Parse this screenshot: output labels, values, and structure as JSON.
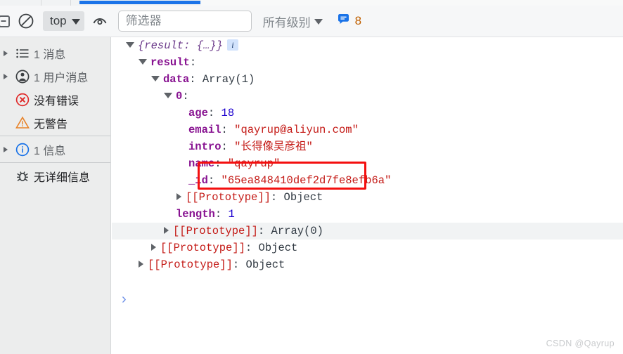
{
  "window": {
    "app": "Chrome DevTools",
    "active_panel": "Console"
  },
  "toolbar": {
    "panel_toggle_icon": "dock-panel-icon",
    "clear_console_icon": "clear-console-icon",
    "context_label": "top",
    "context_caret_icon": "chevron-down-icon",
    "eye_icon": "live-expression-eye-icon",
    "filter_placeholder": "筛选器",
    "filter_value": "",
    "level_label": "所有级别",
    "level_caret_icon": "chevron-down-icon",
    "issues_icon": "issues-speech-bubble-icon",
    "issues_count": "8",
    "accent_color": "#1a73e8",
    "issues_color": "#c06000"
  },
  "sidebar": {
    "items": [
      {
        "label": "1 消息",
        "icon": "message-list-icon",
        "expandable": true,
        "strong": false
      },
      {
        "label": "1 用户消息",
        "icon": "user-message-icon",
        "expandable": true,
        "strong": false
      },
      {
        "label": "没有错误",
        "icon": "error-circle-icon",
        "expandable": false,
        "strong": true
      },
      {
        "label": "无警告",
        "icon": "warning-triangle-icon",
        "expandable": false,
        "strong": true
      },
      {
        "label": "1 信息",
        "icon": "info-circle-icon",
        "expandable": true,
        "strong": false
      },
      {
        "label": "无详细信息",
        "icon": "verbose-bug-icon",
        "expandable": false,
        "strong": true
      }
    ]
  },
  "console": {
    "rows": [
      {
        "indent": 0,
        "twist": "open",
        "type": "preview",
        "text": "{result: {…}}",
        "badge": "i"
      },
      {
        "indent": 1,
        "twist": "open",
        "type": "prop",
        "key": "result",
        "sep": ":",
        "value": ""
      },
      {
        "indent": 2,
        "twist": "open",
        "type": "prop",
        "key": "data",
        "sep": ":",
        "value": "Array(1)",
        "value_kind": "obj"
      },
      {
        "indent": 3,
        "twist": "open",
        "type": "prop",
        "key": "0",
        "sep": ":",
        "value": ""
      },
      {
        "indent": 4,
        "twist": "none",
        "type": "prop",
        "key": "age",
        "sep": ":",
        "value": "18",
        "value_kind": "num"
      },
      {
        "indent": 4,
        "twist": "none",
        "type": "prop",
        "key": "email",
        "sep": ":",
        "value": "\"qayrup@aliyun.com\"",
        "value_kind": "str"
      },
      {
        "indent": 4,
        "twist": "none",
        "type": "prop",
        "key": "intro",
        "sep": ":",
        "value": "\"长得像吴彦祖\"",
        "value_kind": "str"
      },
      {
        "indent": 4,
        "twist": "none",
        "type": "prop",
        "key": "name",
        "sep": ":",
        "value": "\"qayrup\"",
        "value_kind": "str"
      },
      {
        "indent": 4,
        "twist": "none",
        "type": "prop",
        "key": "_id",
        "sep": ":",
        "value": "\"65ea848410def2d7fe8efb6a\"",
        "value_kind": "str"
      },
      {
        "indent": 4,
        "twist": "closed",
        "type": "proto",
        "key": "[[Prototype]]",
        "sep": ":",
        "value": "Object",
        "value_kind": "obj"
      },
      {
        "indent": 3,
        "twist": "none",
        "type": "prop",
        "key": "length",
        "sep": ":",
        "value": "1",
        "value_kind": "num"
      },
      {
        "indent": 3,
        "twist": "closed",
        "type": "proto",
        "key": "[[Prototype]]",
        "sep": ":",
        "value": "Array(0)",
        "value_kind": "obj",
        "highlight": true
      },
      {
        "indent": 2,
        "twist": "closed",
        "type": "proto",
        "key": "[[Prototype]]",
        "sep": ":",
        "value": "Object",
        "value_kind": "obj"
      },
      {
        "indent": 1,
        "twist": "closed",
        "type": "proto",
        "key": "[[Prototype]]",
        "sep": ":",
        "value": "Object",
        "value_kind": "obj"
      }
    ],
    "prompt_chevron": "›"
  },
  "annotation": {
    "shape": "rectangle",
    "color": "#f40f0f",
    "targets_row_key": "name"
  },
  "watermark": {
    "text": "CSDN @Qayrup"
  }
}
